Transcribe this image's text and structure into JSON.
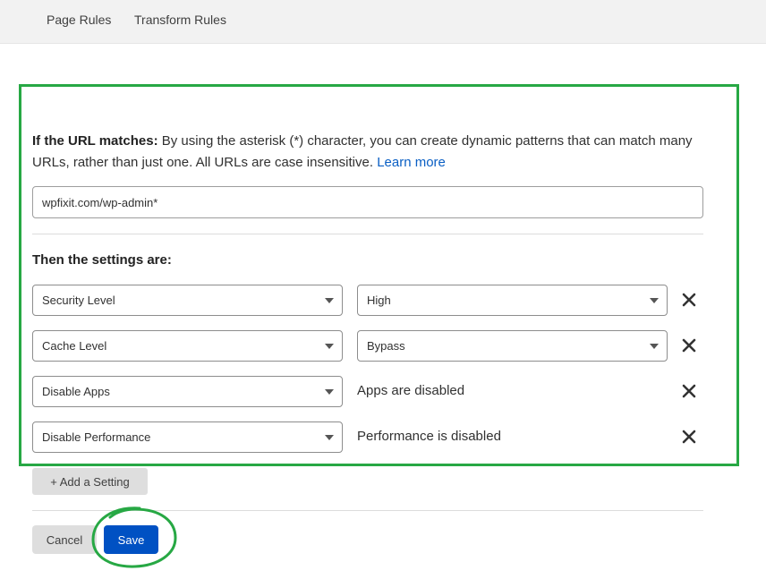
{
  "tabs": [
    {
      "label": "Page Rules"
    },
    {
      "label": "Transform Rules"
    }
  ],
  "url_section": {
    "heading": "If the URL matches:",
    "description": " By using the asterisk (*) character, you can create dynamic patterns that can match many URLs, rather than just one. All URLs are case insensitive. ",
    "learn_more": "Learn more",
    "input_value": "wpfixit.com/wp-admin*"
  },
  "settings": {
    "heading": "Then the settings are:",
    "rows": [
      {
        "setting": "Security Level",
        "value": "High"
      },
      {
        "setting": "Cache Level",
        "value": "Bypass"
      },
      {
        "setting": "Disable Apps",
        "value": "Apps are disabled"
      },
      {
        "setting": "Disable Performance",
        "value": "Performance is disabled"
      }
    ],
    "add_label": "+ Add a Setting"
  },
  "actions": {
    "cancel_label": "Cancel",
    "save_label": "Save"
  },
  "colors": {
    "highlight": "#27a844",
    "primary": "#0051c3",
    "link": "#0a5fc4"
  },
  "icons": {
    "remove": "close-icon",
    "dropdown": "chevron-down-icon"
  }
}
